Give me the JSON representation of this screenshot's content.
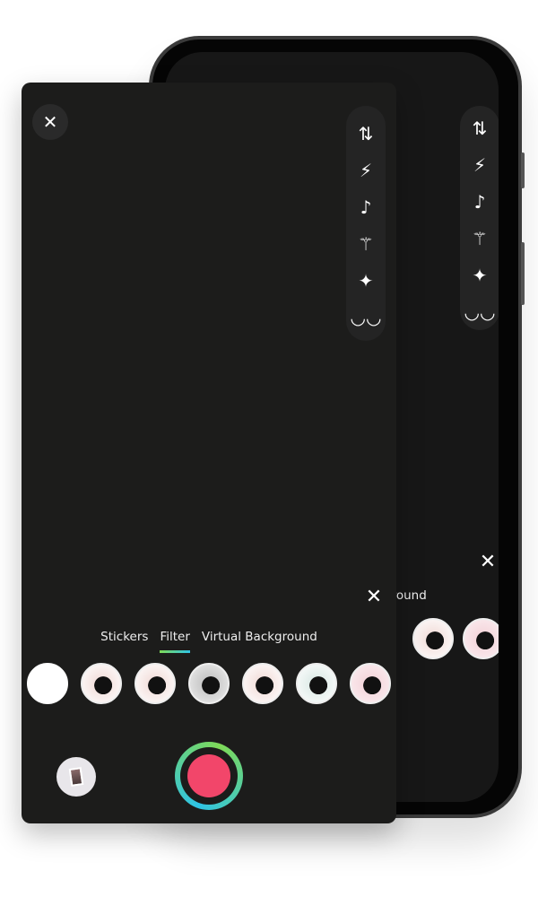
{
  "colors": {
    "record": "#f2466a",
    "accent_start": "#7ed957",
    "accent_end": "#2ec4e6",
    "background": "#1c1c1b"
  },
  "back_phone": {
    "tab_partial": "ground"
  },
  "toolbar": {
    "icons": [
      "flip-camera-icon",
      "flash-icon",
      "music-icon",
      "magic-wand-icon",
      "sparkles-icon",
      "mask-icon"
    ]
  },
  "tabs": [
    {
      "label": "Stickers",
      "active": false
    },
    {
      "label": "Filter",
      "active": true
    },
    {
      "label": "Virtual Background",
      "active": false
    }
  ],
  "filters": [
    "none",
    "original",
    "warm",
    "mono",
    "light",
    "cool",
    "pink"
  ]
}
